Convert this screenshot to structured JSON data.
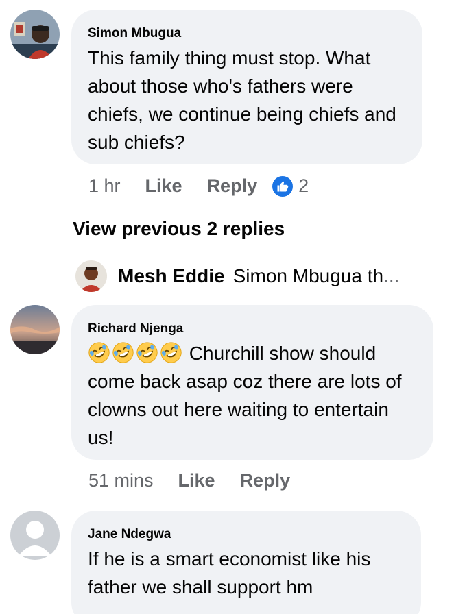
{
  "comments": [
    {
      "author": "Simon Mbugua",
      "text": "This family thing must stop. What about those who's fathers were chiefs, we continue being chiefs and sub chiefs?",
      "time": "1 hr",
      "like_label": "Like",
      "reply_label": "Reply",
      "reaction_count": "2",
      "avatar_icon": "avatar-photo"
    },
    {
      "author": "Richard Njenga",
      "emoji_icon": "rolling-on-floor-laughing-emoji",
      "emoji_count": 4,
      "text": "Churchill show should come back asap coz there are lots of clowns out here waiting to entertain us!",
      "time": "51 mins",
      "like_label": "Like",
      "reply_label": "Reply",
      "avatar_icon": "avatar-sunset-photo"
    },
    {
      "author": "Jane Ndegwa",
      "text": "If he is a smart economist like his father we shall support hm",
      "avatar_icon": "default-avatar-icon"
    }
  ],
  "replies_thread": {
    "view_previous_label": "View previous 2 replies",
    "latest_reply": {
      "author": "Mesh Eddie",
      "text_truncated": "Simon Mbugua th",
      "ellipsis": "..."
    }
  },
  "colors": {
    "bubble_bg": "#f0f2f5",
    "secondary_text": "#65676b",
    "like_blue": "#1b74e4"
  }
}
